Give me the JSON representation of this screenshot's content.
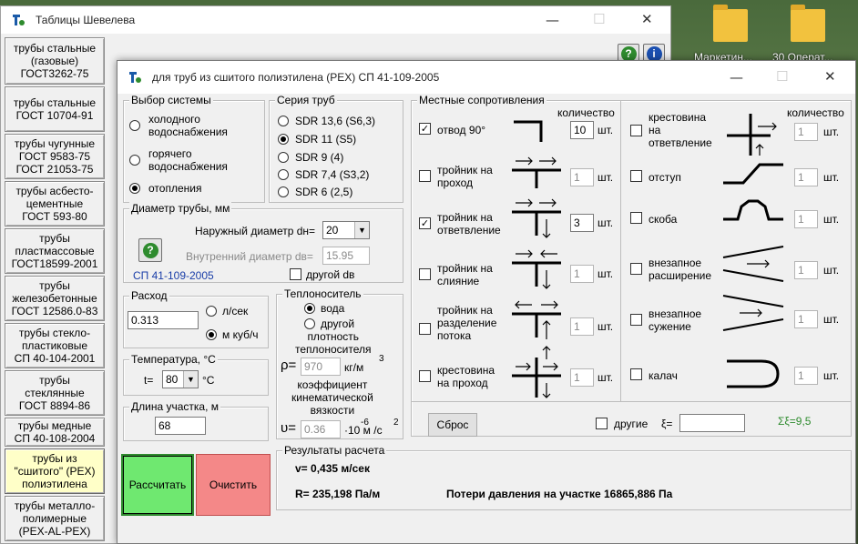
{
  "desktop": {
    "icons": [
      {
        "label": "Маркетин..."
      },
      {
        "label": "30 Операт..."
      }
    ]
  },
  "back_window": {
    "title": "Таблицы Шевелева",
    "left_buttons": [
      {
        "label": "трубы стальные\n(газовые)\nГОСТ3262-75"
      },
      {
        "label": "трубы стальные\nГОСТ 10704-91"
      },
      {
        "label": "трубы  чугунные\nГОСТ 9583-75\nГОСТ 21053-75"
      },
      {
        "label": "трубы асбесто-\nцементные\nГОСТ 593-80"
      },
      {
        "label": "трубы\nпластмассовые\nГОСТ18599-2001"
      },
      {
        "label": "трубы\nжелезобетонные\nГОСТ 12586.0-83"
      },
      {
        "label": "трубы стекло-\nпластиковые\nСП 40-104-2001"
      },
      {
        "label": "трубы\nстеклянные\nГОСТ 8894-86"
      },
      {
        "label": "трубы медные\nСП 40-108-2004"
      },
      {
        "label": "трубы из\n\"сшитого\" (PEX)\nполиэтилена"
      },
      {
        "label": "трубы металло-\nполимерные\n(PEX-AL-PEX)"
      }
    ],
    "help_icons": [
      {
        "symbol": "?"
      },
      {
        "symbol": "i"
      }
    ]
  },
  "window": {
    "title": "для труб из сшитого полиэтилена (PEX) СП 41-109-2005",
    "system": {
      "title": "Выбор системы",
      "options": [
        {
          "label": "холодного\nводоснабжения",
          "selected": false
        },
        {
          "label": "горячего\nводоснабжения",
          "selected": false
        },
        {
          "label": "отопления",
          "selected": true
        }
      ]
    },
    "series": {
      "title": "Серия труб",
      "options": [
        {
          "label": "SDR 13,6 (S6,3)",
          "selected": false
        },
        {
          "label": "SDR 11 (S5)",
          "selected": true
        },
        {
          "label": "SDR 9 (4)",
          "selected": false
        },
        {
          "label": "SDR 7,4 (S3,2)",
          "selected": false
        },
        {
          "label": "SDR 6 (2,5)",
          "selected": false
        }
      ]
    },
    "diameter": {
      "title": "Диаметр трубы, мм",
      "outer_label": "Наружный диаметр dн=",
      "outer_value": "20",
      "inner_label": "Внутренний диаметр dв=",
      "inner_value": "15.95",
      "link_text": "СП 41-109-2005",
      "other_label": "другой dв",
      "help_symbol": "?"
    },
    "flow": {
      "title": "Расход",
      "value": "0.313",
      "unit_options": [
        {
          "label": "л/сек",
          "selected": false
        },
        {
          "label": "м куб/ч",
          "selected": true
        }
      ]
    },
    "temperature": {
      "title": "Температура, °С",
      "prefix": "t=",
      "value": "80",
      "unit": "°С"
    },
    "length": {
      "title": "Длина участка, м",
      "value": "68"
    },
    "coolant": {
      "title": "Теплоноситель",
      "options": [
        {
          "label": "вода",
          "selected": true
        },
        {
          "label": "другой",
          "selected": false
        }
      ],
      "density_label": "плотность\nтеплоносителя",
      "density_symbol": "ρ=",
      "density_value": "970",
      "density_unit": "кг/м",
      "density_exp": "3",
      "viscosity_label": "коэффициент\nкинематической\nвязкости",
      "viscosity_symbol": "υ=",
      "viscosity_value": "0.36",
      "viscosity_unit": "·10 м /с",
      "viscosity_exp1": "-6",
      "viscosity_exp2": "2"
    },
    "local_resistances": {
      "title": "Местные сопротивления",
      "qty_header": "количество",
      "unit": "шт.",
      "left": [
        {
          "label": "отвод 90°",
          "checked": true,
          "qty": "10",
          "symbol": "elbow"
        },
        {
          "label": "тройник на\nпроход",
          "checked": false,
          "qty": "1",
          "symbol": "tee-pass"
        },
        {
          "label": "тройник на\nответвление",
          "checked": true,
          "qty": "3",
          "symbol": "tee-branch"
        },
        {
          "label": "тройник на\nслияние",
          "checked": false,
          "qty": "1",
          "symbol": "tee-merge"
        },
        {
          "label": "тройник на\nразделение\nпотока",
          "checked": false,
          "qty": "1",
          "symbol": "tee-split"
        },
        {
          "label": "крестовина\nна проход",
          "checked": false,
          "qty": "1",
          "symbol": "cross-pass"
        }
      ],
      "right": [
        {
          "label": "крестовина\nна\nответвление",
          "checked": false,
          "qty": "1",
          "symbol": "cross-branch"
        },
        {
          "label": "отступ",
          "checked": false,
          "qty": "1",
          "symbol": "offset"
        },
        {
          "label": "скоба",
          "checked": false,
          "qty": "1",
          "symbol": "bracket"
        },
        {
          "label": "внезапное\nрасширение",
          "checked": false,
          "qty": "1",
          "symbol": "expansion"
        },
        {
          "label": "внезапное\nсужение",
          "checked": false,
          "qty": "1",
          "symbol": "contraction"
        },
        {
          "label": "калач",
          "checked": false,
          "qty": "1",
          "symbol": "u-bend"
        }
      ],
      "reset_label": "Сброс",
      "other_label": "другие",
      "xi_label": "ξ=",
      "xi_value": "",
      "sum_label": "Σξ=9,5"
    },
    "results": {
      "title": "Результаты расчета",
      "velocity": "v= 0,435 м/сек",
      "resistance": "R= 235,198 Па/м",
      "pressure_loss": "Потери давления на участке 16865,886 Па"
    },
    "calculate_label": "Рассчитать",
    "clear_label": "Очистить"
  },
  "colors": {
    "calc_button": "#6fe870",
    "clear_button": "#f48888",
    "sum_text": "#2e8b2e",
    "link": "#1a3ea8",
    "active_button": "#ffffc8"
  }
}
